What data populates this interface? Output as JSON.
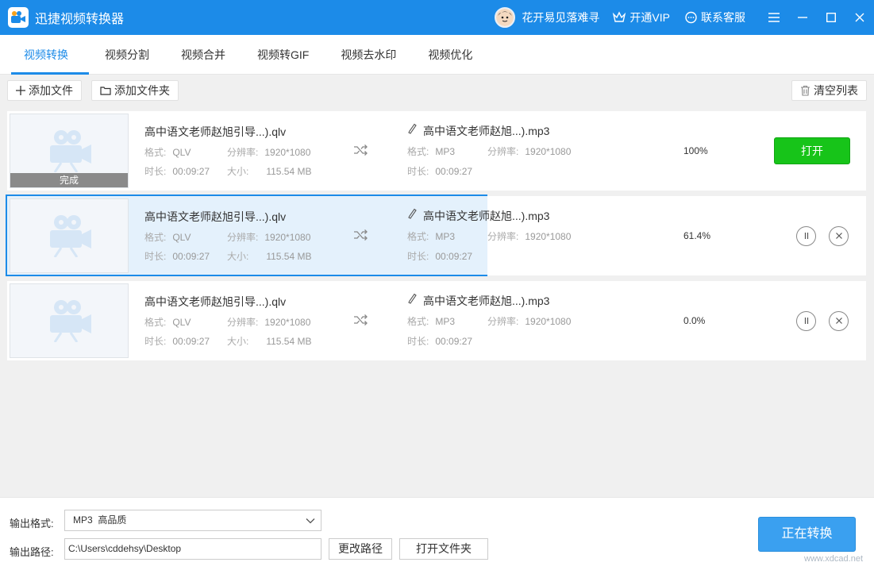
{
  "app": {
    "title": "迅捷视频转换器"
  },
  "header": {
    "username": "花开易见落难寻",
    "vip_label": "开通VIP",
    "support_label": "联系客服"
  },
  "tabs": [
    "视频转换",
    "视频分割",
    "视频合并",
    "视频转GIF",
    "视频去水印",
    "视频优化"
  ],
  "toolbar": {
    "add_file": "添加文件",
    "add_folder": "添加文件夹",
    "clear_list": "清空列表"
  },
  "labels": {
    "format": "格式:",
    "resolution": "分辨率:",
    "duration": "时长:",
    "size": "大小:",
    "done": "完成",
    "open": "打开"
  },
  "rows": [
    {
      "src_name": "高中语文老师赵旭引导...).qlv",
      "src_format": "QLV",
      "src_resolution": "1920*1080",
      "src_duration": "00:09:27",
      "src_size": "115.54 MB",
      "out_name": "高中语文老师赵旭...).mp3",
      "out_format": "MP3",
      "out_resolution": "1920*1080",
      "out_duration": "00:09:27",
      "progress": "100%",
      "status": "done"
    },
    {
      "src_name": "高中语文老师赵旭引导...).qlv",
      "src_format": "QLV",
      "src_resolution": "1920*1080",
      "src_duration": "00:09:27",
      "src_size": "115.54 MB",
      "out_name": "高中语文老师赵旭...).mp3",
      "out_format": "MP3",
      "out_resolution": "1920*1080",
      "out_duration": "00:09:27",
      "progress": "61.4%",
      "status": "converting"
    },
    {
      "src_name": "高中语文老师赵旭引导...).qlv",
      "src_format": "QLV",
      "src_resolution": "1920*1080",
      "src_duration": "00:09:27",
      "src_size": "115.54 MB",
      "out_name": "高中语文老师赵旭...).mp3",
      "out_format": "MP3",
      "out_resolution": "1920*1080",
      "out_duration": "00:09:27",
      "progress": "0.0%",
      "status": "waiting"
    }
  ],
  "bottom": {
    "format_label": "输出格式:",
    "format_value": "MP3  高品质",
    "path_label": "输出路径:",
    "path_value": "C:\\Users\\cddehsy\\Desktop",
    "change_path": "更改路径",
    "open_folder": "打开文件夹",
    "convert": "正在转换"
  },
  "watermark": "www.xdcad.net",
  "colors": {
    "accent": "#1c8be8",
    "open_green": "#17c419"
  }
}
